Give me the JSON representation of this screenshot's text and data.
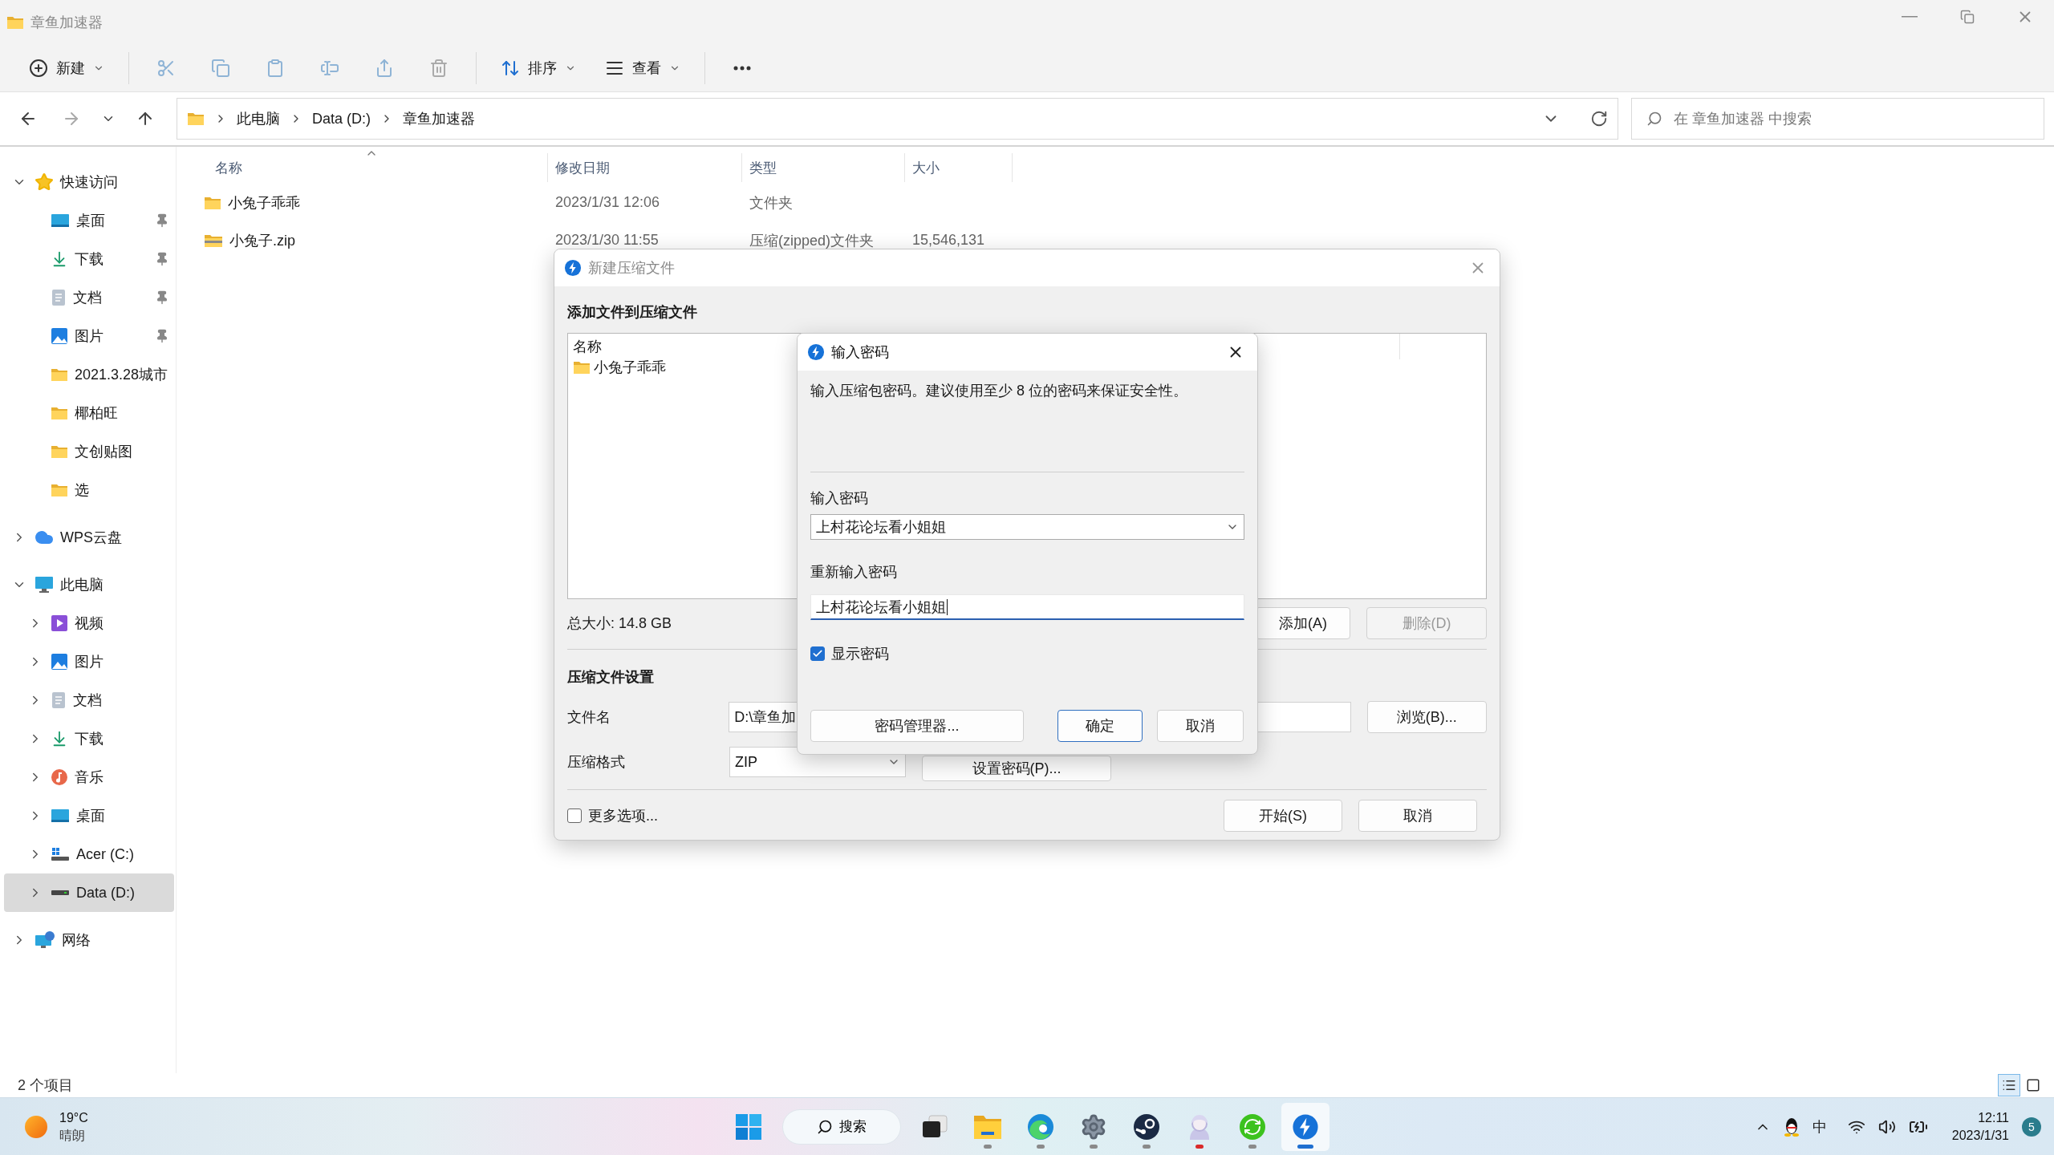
{
  "window": {
    "title": "章鱼加速器"
  },
  "command_bar": {
    "items": [
      {
        "kind": "new",
        "label": "新建",
        "disabled": false
      },
      {
        "kind": "cut",
        "disabled": true
      },
      {
        "kind": "copy",
        "disabled": true
      },
      {
        "kind": "paste",
        "disabled": true
      },
      {
        "kind": "rename",
        "disabled": true
      },
      {
        "kind": "share",
        "disabled": true
      },
      {
        "kind": "delete",
        "disabled": true
      },
      {
        "kind": "sort",
        "label": "排序",
        "disabled": false
      },
      {
        "kind": "view",
        "label": "查看",
        "disabled": false
      },
      {
        "kind": "more",
        "disabled": false
      }
    ]
  },
  "address": {
    "crumbs": [
      "此电脑",
      "Data (D:)",
      "章鱼加速器"
    ]
  },
  "search": {
    "placeholder": "在 章鱼加速器 中搜索"
  },
  "sidebar": {
    "items": [
      {
        "label": "快速访问",
        "kind": "star",
        "expanded": true,
        "selected": false,
        "children": [
          {
            "label": "桌面",
            "kind": "desktop",
            "pinned": true,
            "selected": false
          },
          {
            "label": "下载",
            "kind": "download",
            "pinned": true,
            "selected": false
          },
          {
            "label": "文档",
            "kind": "docs",
            "pinned": true,
            "selected": false
          },
          {
            "label": "图片",
            "kind": "pictures",
            "pinned": true,
            "selected": false
          },
          {
            "label": "2021.3.28城市",
            "kind": "folder",
            "pinned": false,
            "selected": false
          },
          {
            "label": "椰柏旺",
            "kind": "folder",
            "pinned": false,
            "selected": false
          },
          {
            "label": "文创贴图",
            "kind": "folder",
            "pinned": false,
            "selected": false
          },
          {
            "label": "选",
            "kind": "folder",
            "pinned": false,
            "selected": false
          }
        ]
      },
      {
        "label": "WPS云盘",
        "kind": "cloud",
        "expanded": false,
        "selected": false
      },
      {
        "label": "此电脑",
        "kind": "pc",
        "expanded": true,
        "selected": false,
        "children": [
          {
            "label": "视频",
            "kind": "video",
            "expanded": false,
            "selected": false
          },
          {
            "label": "图片",
            "kind": "pictures",
            "expanded": false,
            "selected": false
          },
          {
            "label": "文档",
            "kind": "docs",
            "expanded": false,
            "selected": false
          },
          {
            "label": "下载",
            "kind": "download",
            "expanded": false,
            "selected": false
          },
          {
            "label": "音乐",
            "kind": "music",
            "expanded": false,
            "selected": false
          },
          {
            "label": "桌面",
            "kind": "desktop",
            "expanded": false,
            "selected": false
          },
          {
            "label": "Acer (C:)",
            "kind": "drive_c",
            "expanded": false,
            "selected": false
          },
          {
            "label": "Data (D:)",
            "kind": "drive_d",
            "expanded": false,
            "selected": true
          }
        ]
      },
      {
        "label": "网络",
        "kind": "network",
        "expanded": false,
        "selected": false
      }
    ]
  },
  "file_list": {
    "columns": [
      "名称",
      "修改日期",
      "类型",
      "大小"
    ],
    "rows": [
      {
        "kind": "folder",
        "name": "小兔子乖乖",
        "date": "2023/1/31 12:06",
        "type": "文件夹"
      },
      {
        "kind": "zip",
        "name": "小兔子.zip",
        "date": "2023/1/30 11:55",
        "type": "压缩(zipped)文件夹",
        "size": "15,546,131"
      }
    ]
  },
  "status_bar": {
    "count": "2 个项目",
    "views": [
      {
        "kind": "details",
        "selected": true
      },
      {
        "kind": "tiles",
        "selected": false
      }
    ]
  },
  "archive_dialog": {
    "title": "新建压缩文件",
    "heading": "添加文件到压缩文件",
    "list_header": "名称",
    "files": [
      {
        "kind": "folder",
        "name": "小兔子乖乖"
      }
    ],
    "total_size": "总大小: 14.8 GB",
    "list_buttons": [
      {
        "label": "添加(A)",
        "disabled": false
      },
      {
        "label": "删除(D)",
        "disabled": true
      }
    ],
    "settings_heading": "压缩文件设置",
    "filename_label": "文件名",
    "filename": "D:\\章鱼加",
    "browse": "浏览(B)...",
    "format_label": "压缩格式",
    "format": "ZIP",
    "set_password": "设置密码(P)...",
    "more_options": {
      "label": "更多选项...",
      "checked": false
    },
    "buttons": [
      "开始(S)",
      "取消"
    ]
  },
  "password_dialog": {
    "title": "输入密码",
    "message": "输入压缩包密码。建议使用至少 8 位的密码来保证安全性。",
    "password_label": "输入密码",
    "password": "上村花论坛看小姐姐",
    "confirm_label": "重新输入密码",
    "confirm": "上村花论坛看小姐姐",
    "show_password": {
      "label": "显示密码",
      "checked": true
    },
    "buttons": [
      {
        "label": "密码管理器...",
        "default": false
      },
      {
        "label": "确定",
        "default": true
      },
      {
        "label": "取消",
        "default": false
      }
    ]
  },
  "taskbar": {
    "weather": {
      "temp": "19°C",
      "condition": "晴朗"
    },
    "search": "搜索",
    "apps": [
      {
        "kind": "start",
        "running": false,
        "active": false
      },
      {
        "kind": "taskview",
        "running": false,
        "active": false
      },
      {
        "kind": "explorer",
        "running": true,
        "active": false,
        "color": "#8a8a8a"
      },
      {
        "kind": "browser",
        "running": true,
        "active": false,
        "color": "#8a8a8a"
      },
      {
        "kind": "settings",
        "running": true,
        "active": false,
        "color": "#8a8a8a"
      },
      {
        "kind": "steam",
        "running": true,
        "active": false,
        "color": "#8a8a8a"
      },
      {
        "kind": "figure",
        "running": true,
        "active": false,
        "color": "#d92a2a"
      },
      {
        "kind": "sync",
        "running": true,
        "active": false,
        "color": "#8a8a8a"
      },
      {
        "kind": "bolt",
        "running": true,
        "active": true,
        "color": "#1f6fd0"
      }
    ],
    "ime": "中",
    "time": "12:11",
    "date": "2023/1/31",
    "badge": "5"
  }
}
